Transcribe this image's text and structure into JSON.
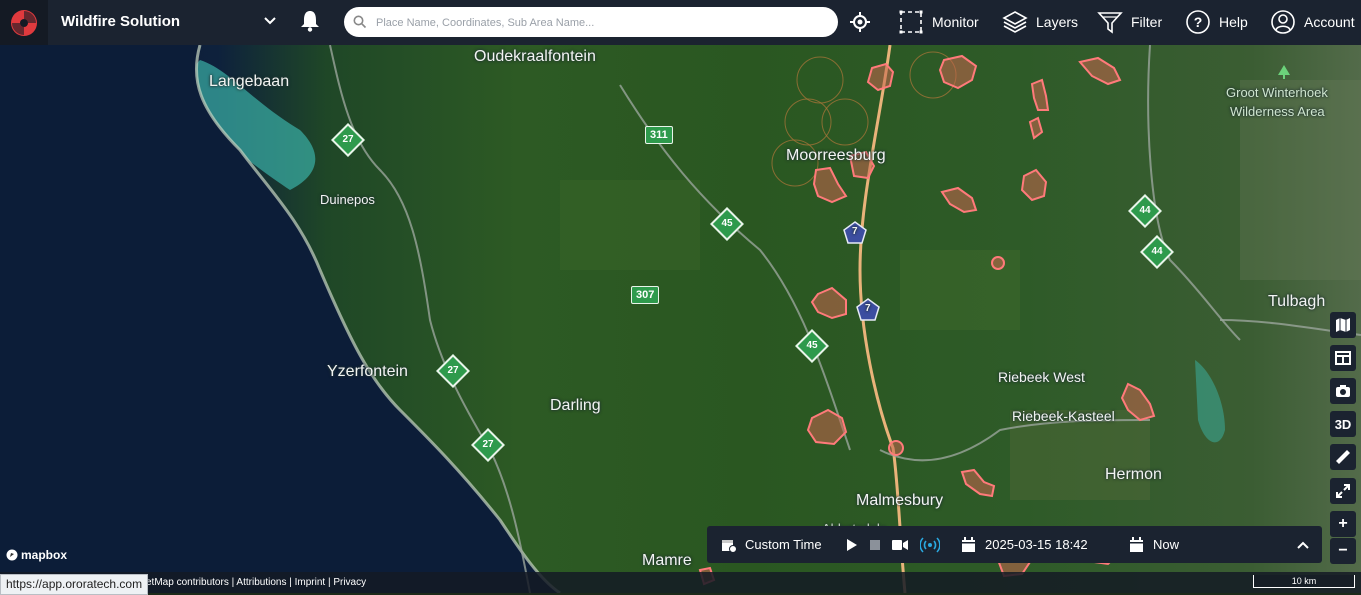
{
  "app": {
    "title": "Wildfire Solution"
  },
  "search": {
    "placeholder": "Place Name, Coordinates, Sub Area Name..."
  },
  "nav": [
    {
      "label": "Monitor",
      "icon": "monitor-frame-icon"
    },
    {
      "label": "Layers",
      "icon": "layers-icon"
    },
    {
      "label": "Filter",
      "icon": "filter-icon"
    },
    {
      "label": "Help",
      "icon": "help-icon"
    },
    {
      "label": "Account",
      "icon": "account-icon"
    }
  ],
  "map": {
    "places": [
      "Oudekraalfontein",
      "Langebaan",
      "Duinepos",
      "Moorreesburg",
      "Groot Winterhoek",
      "Wilderness Area",
      "Tulbagh",
      "Yzerfontein",
      "Darling",
      "Riebeek West",
      "Riebeek-Kasteel",
      "Hermon",
      "Malmesbury",
      "Abbotsdale",
      "Mamre"
    ],
    "route_shields": [
      "27",
      "27",
      "27",
      "45",
      "45",
      "7",
      "7",
      "44",
      "44"
    ],
    "route_boxes": [
      "311",
      "307"
    ],
    "tools": [
      "map-icon",
      "layout-icon",
      "camera-icon",
      "3D",
      "ruler-icon",
      "expand-icon",
      "+",
      "−"
    ]
  },
  "timebar": {
    "mode_label": "Custom Time",
    "start": "2025-03-15 18:42",
    "end": "Now"
  },
  "footer": {
    "url": "https://app.ororatech.com",
    "attribution": "etMap contributors | Attributions | Imprint | Privacy",
    "mapbox": "mapbox",
    "scale": "10 km"
  },
  "colors": {
    "topbar": "#1b2330",
    "accent": "#e03a3e",
    "fire": "#f26a6a",
    "live": "#2aa9e0"
  }
}
